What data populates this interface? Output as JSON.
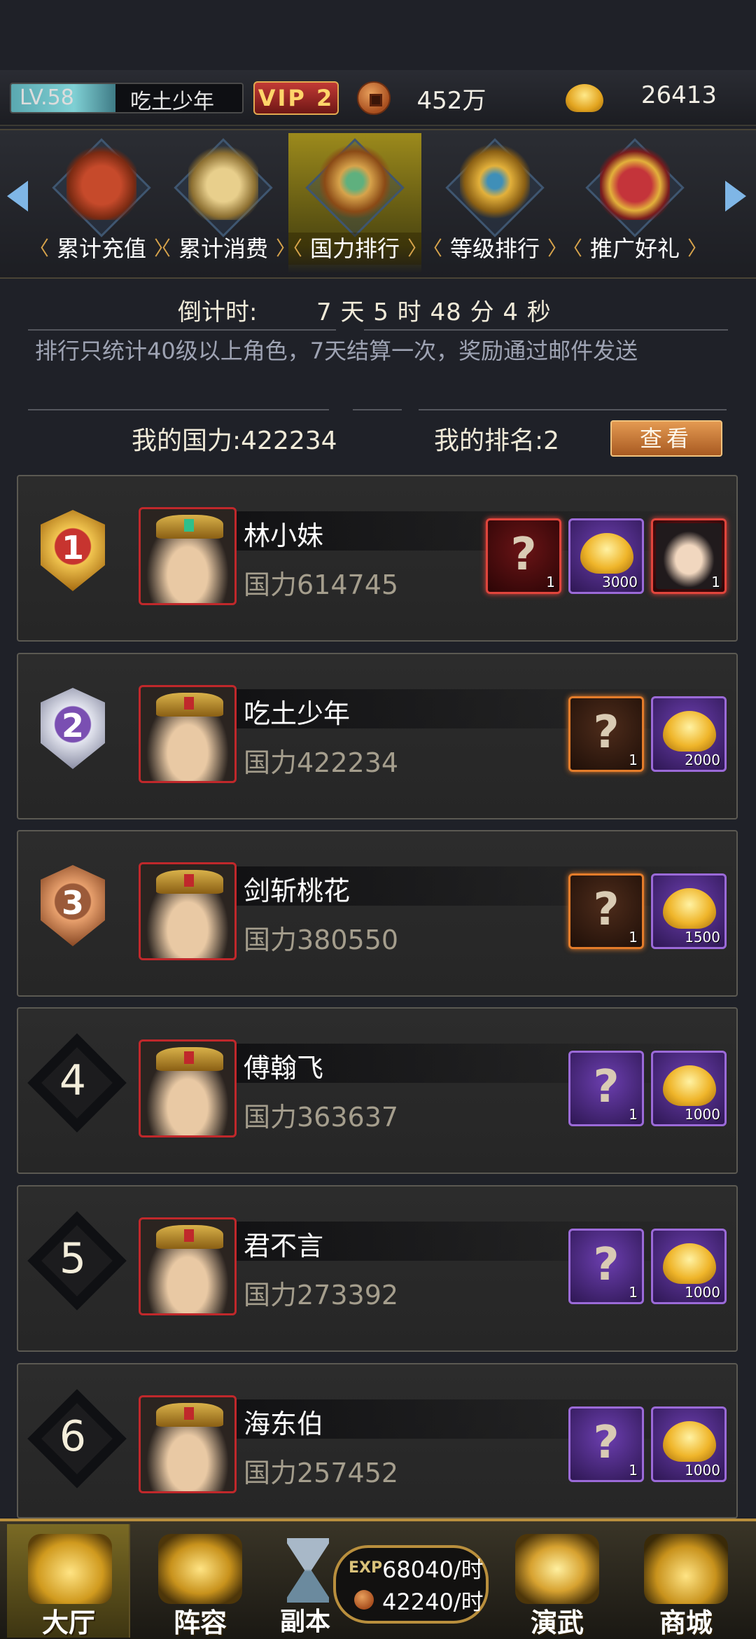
{
  "header": {
    "level": "LV.58",
    "level_progress": 0.45,
    "player_name": "吃土少年",
    "vip": "VIP 2",
    "copper": "452万",
    "gold": "26413"
  },
  "tabs": [
    {
      "label": "累计充值",
      "active": false
    },
    {
      "label": "累计消费",
      "active": false
    },
    {
      "label": "国力排行",
      "active": true
    },
    {
      "label": "等级排行",
      "active": false
    },
    {
      "label": "推广好礼",
      "active": false
    }
  ],
  "info": {
    "countdown_label": "倒计时:",
    "countdown_value": "7 天 5 时 48 分 4 秒",
    "rule": "排行只统计40级以上角色，7天结算一次，奖励通过邮件发送",
    "my_power": "我的国力:422234",
    "my_rank": "我的排名:2",
    "view_button": "查看"
  },
  "rankings": [
    {
      "rank": "1",
      "name": "林小妹",
      "power": "国力614745",
      "rewards": [
        {
          "type": "mystery",
          "frame": "red",
          "qty": "1"
        },
        {
          "type": "gold",
          "frame": "purple",
          "qty": "3000"
        },
        {
          "type": "hero",
          "frame": "red",
          "qty": "1"
        }
      ]
    },
    {
      "rank": "2",
      "name": "吃土少年",
      "power": "国力422234",
      "rewards": [
        {
          "type": "mystery",
          "frame": "orange",
          "qty": "1"
        },
        {
          "type": "gold",
          "frame": "purple",
          "qty": "2000"
        }
      ]
    },
    {
      "rank": "3",
      "name": "剑斩桃花",
      "power": "国力380550",
      "rewards": [
        {
          "type": "mystery",
          "frame": "orange",
          "qty": "1"
        },
        {
          "type": "gold",
          "frame": "purple",
          "qty": "1500"
        }
      ]
    },
    {
      "rank": "4",
      "name": "傅翰飞",
      "power": "国力363637",
      "rewards": [
        {
          "type": "mystery",
          "frame": "purple",
          "qty": "1"
        },
        {
          "type": "gold",
          "frame": "purple",
          "qty": "1000"
        }
      ]
    },
    {
      "rank": "5",
      "name": "君不言",
      "power": "国力273392",
      "rewards": [
        {
          "type": "mystery",
          "frame": "purple",
          "qty": "1"
        },
        {
          "type": "gold",
          "frame": "purple",
          "qty": "1000"
        }
      ]
    },
    {
      "rank": "6",
      "name": "海东伯",
      "power": "国力257452",
      "rewards": [
        {
          "type": "mystery",
          "frame": "purple",
          "qty": "1"
        },
        {
          "type": "gold",
          "frame": "purple",
          "qty": "1000"
        }
      ]
    }
  ],
  "bottom_nav": {
    "hall": "大厅",
    "lineup": "阵容",
    "dungeon": "副本",
    "exp_tag": "EXP",
    "exp_rate": "68040/时",
    "coin_rate": "42240/时",
    "arena": "演武",
    "shop": "商城"
  },
  "colors": {
    "background": "#1f2128",
    "accent_gold": "#d7a34b",
    "vip_red": "#c23a35",
    "power_text": "#a59e8d"
  }
}
